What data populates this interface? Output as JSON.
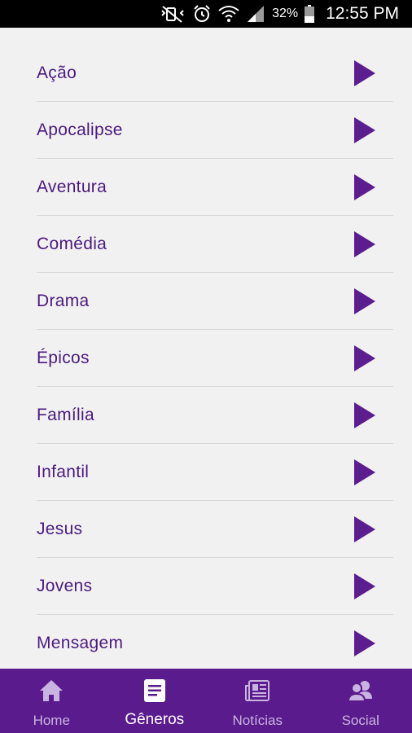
{
  "status_bar": {
    "battery": "32%",
    "time": "12:55 PM"
  },
  "genres": [
    {
      "label": "Ação"
    },
    {
      "label": "Apocalipse"
    },
    {
      "label": "Aventura"
    },
    {
      "label": "Comédia"
    },
    {
      "label": "Drama"
    },
    {
      "label": "Épicos"
    },
    {
      "label": "Família"
    },
    {
      "label": "Infantil"
    },
    {
      "label": "Jesus"
    },
    {
      "label": "Jovens"
    },
    {
      "label": "Mensagem"
    }
  ],
  "bottom_nav": {
    "items": [
      {
        "label": "Home",
        "icon": "home-icon"
      },
      {
        "label": "Gêneros",
        "icon": "document-icon",
        "active": true
      },
      {
        "label": "Notícias",
        "icon": "newspaper-icon"
      },
      {
        "label": "Social",
        "icon": "people-icon"
      }
    ]
  },
  "colors": {
    "accent": "#5a1b8c",
    "label_text": "#4a1a7e",
    "arrow": "#5c1d8f"
  }
}
